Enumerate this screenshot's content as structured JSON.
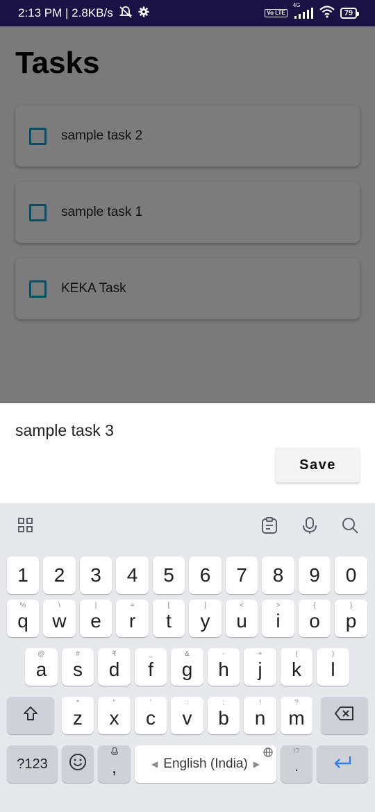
{
  "status": {
    "time_speed": "2:13 PM | 2.8KB/s",
    "volte": "Vo LTE",
    "network": "4G",
    "battery": "79"
  },
  "app": {
    "title": "Tasks",
    "tasks": [
      {
        "label": "sample task 2",
        "checked": false
      },
      {
        "label": "sample task 1",
        "checked": false
      },
      {
        "label": "KEKA Task",
        "checked": false
      }
    ],
    "overlay_color": "#7a7a7a",
    "checkbox_color": "#0c4d60"
  },
  "sheet": {
    "input_value": "sample task 3",
    "save_label": "Save"
  },
  "keyboard": {
    "numbers": [
      "1",
      "2",
      "3",
      "4",
      "5",
      "6",
      "7",
      "8",
      "9",
      "0"
    ],
    "row1": [
      {
        "key": "q",
        "hint": "%"
      },
      {
        "key": "w",
        "hint": "\\"
      },
      {
        "key": "e",
        "hint": "|"
      },
      {
        "key": "r",
        "hint": "="
      },
      {
        "key": "t",
        "hint": "["
      },
      {
        "key": "y",
        "hint": "]"
      },
      {
        "key": "u",
        "hint": "<"
      },
      {
        "key": "i",
        "hint": ">"
      },
      {
        "key": "o",
        "hint": "{"
      },
      {
        "key": "p",
        "hint": "}"
      }
    ],
    "row2": [
      {
        "key": "a",
        "hint": "@"
      },
      {
        "key": "s",
        "hint": "#"
      },
      {
        "key": "d",
        "hint": "₹"
      },
      {
        "key": "f",
        "hint": "_"
      },
      {
        "key": "g",
        "hint": "&"
      },
      {
        "key": "h",
        "hint": "-"
      },
      {
        "key": "j",
        "hint": "+"
      },
      {
        "key": "k",
        "hint": "("
      },
      {
        "key": "l",
        "hint": ")"
      }
    ],
    "row3": [
      {
        "key": "z",
        "hint": "*"
      },
      {
        "key": "x",
        "hint": "\""
      },
      {
        "key": "c",
        "hint": "'"
      },
      {
        "key": "v",
        "hint": ":"
      },
      {
        "key": "b",
        "hint": ";"
      },
      {
        "key": "n",
        "hint": "!"
      },
      {
        "key": "m",
        "hint": "?"
      }
    ],
    "symbols_label": "?123",
    "comma": ",",
    "space_label": "English (India)",
    "period": ".",
    "period_hint": "!?"
  }
}
